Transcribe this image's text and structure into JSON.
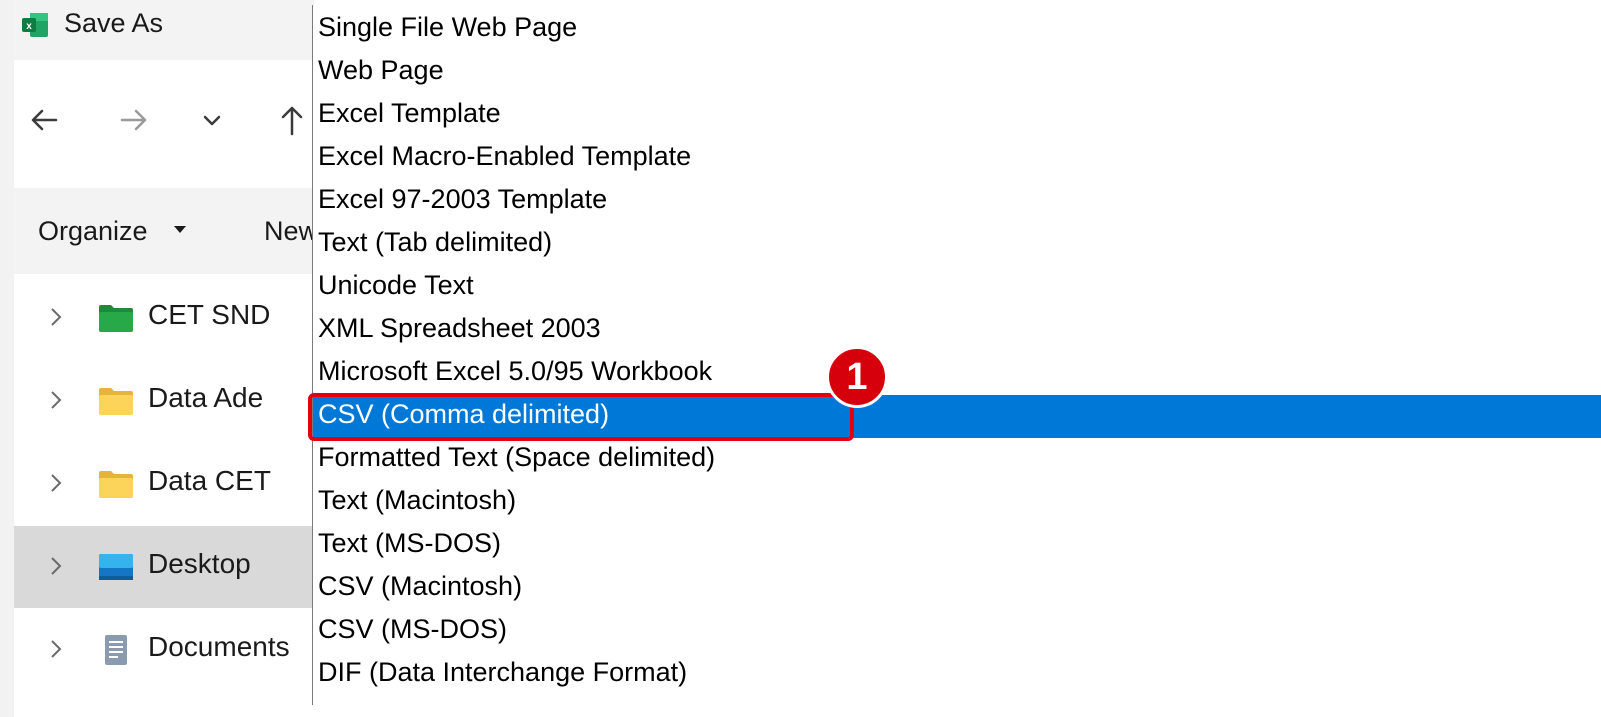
{
  "window": {
    "title": "Save As"
  },
  "toolbar": {
    "organize_label": "Organize",
    "new_folder_label": "New"
  },
  "nav": {
    "items": [
      {
        "label": "CET SND",
        "icon": "green-folder-icon"
      },
      {
        "label": "Data Ade",
        "icon": "folder-icon"
      },
      {
        "label": "Data CET",
        "icon": "folder-icon"
      },
      {
        "label": "Desktop",
        "icon": "desktop-icon"
      },
      {
        "label": "Documents",
        "icon": "documents-icon"
      }
    ]
  },
  "file_types": [
    "Single File Web Page",
    "Web Page",
    "Excel Template",
    "Excel Macro-Enabled Template",
    "Excel 97-2003 Template",
    "Text (Tab delimited)",
    "Unicode Text",
    "XML Spreadsheet 2003",
    "Microsoft Excel 5.0/95 Workbook",
    "CSV (Comma delimited)",
    "Formatted Text (Space delimited)",
    "Text (Macintosh)",
    "Text (MS-DOS)",
    "CSV (Macintosh)",
    "CSV (MS-DOS)",
    "DIF (Data Interchange Format)"
  ],
  "selected_file_type": "CSV (Comma delimited)",
  "annotation": {
    "step_number": "1"
  },
  "colors": {
    "selection": "#0078d7",
    "annotation": "#e3000f"
  }
}
